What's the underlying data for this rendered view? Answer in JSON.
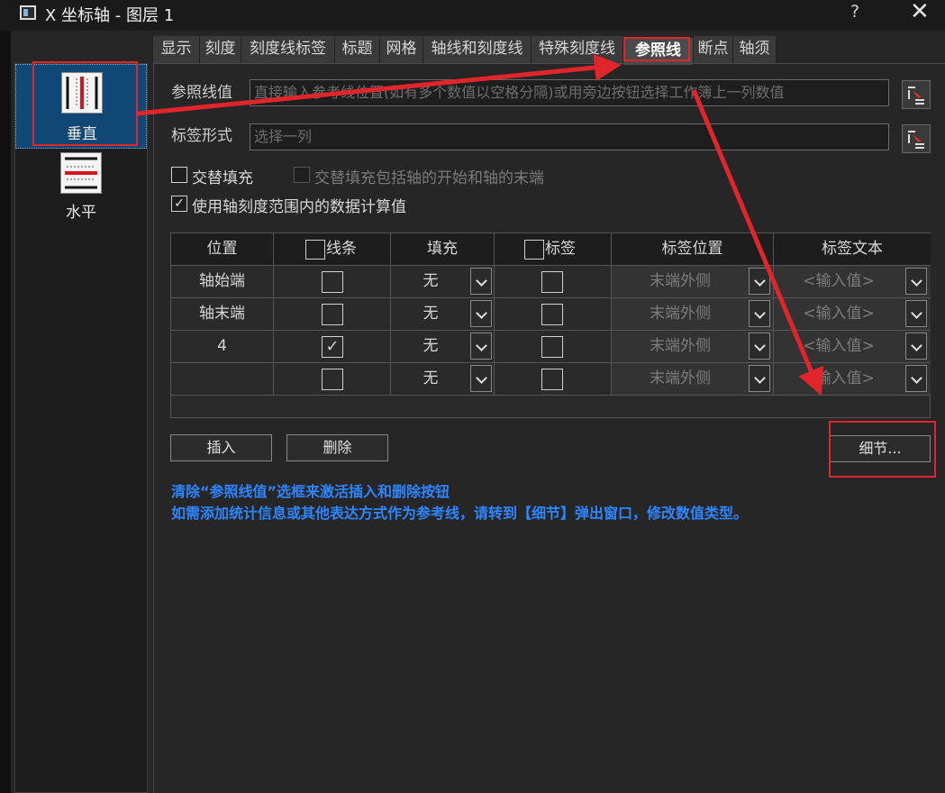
{
  "window": {
    "title": "X 坐标轴 - 图层 1",
    "help_label": "?",
    "close_label": "✕"
  },
  "sidebar": {
    "items": [
      {
        "label": "垂直",
        "icon": "vertical-axis-icon",
        "selected": true
      },
      {
        "label": "水平",
        "icon": "horizontal-axis-icon",
        "selected": false
      }
    ]
  },
  "tabs": [
    "显示",
    "刻度",
    "刻度线标签",
    "标题",
    "网格",
    "轴线和刻度线",
    "特殊刻度线",
    "参照线",
    "断点",
    "轴须"
  ],
  "active_tab": "参照线",
  "form": {
    "ref_value_label": "参照线值",
    "ref_value_placeholder": "直接输入参考线位置(如有多个数值以空格分隔)或用旁边按钮选择工作簿上一列数值",
    "label_format_label": "标签形式",
    "label_format_placeholder": "选择一列",
    "alt_fill_label": "交替填充",
    "alt_fill_checked": false,
    "alt_fill_ends_label": "交替填充包括轴的开始和轴的末端",
    "alt_fill_ends_enabled": false,
    "use_axis_range_label": "使用轴刻度范围内的数据计算值",
    "use_axis_range_checked": true
  },
  "grid": {
    "headers": [
      "位置",
      "线条",
      "填充",
      "标签",
      "标签位置",
      "标签文本"
    ],
    "rows": [
      {
        "position": "轴始端",
        "line": false,
        "fill": "无",
        "label": false,
        "label_pos": "末端外侧",
        "label_text": "<输入值>"
      },
      {
        "position": "轴末端",
        "line": false,
        "fill": "无",
        "label": false,
        "label_pos": "末端外侧",
        "label_text": "<输入值>"
      },
      {
        "position": "4",
        "line": true,
        "fill": "无",
        "label": false,
        "label_pos": "末端外侧",
        "label_text": "<输入值>"
      },
      {
        "position": "",
        "line": false,
        "fill": "无",
        "label": false,
        "label_pos": "末端外侧",
        "label_text": "<输入值>"
      }
    ]
  },
  "buttons": {
    "insert": "插入",
    "delete": "删除",
    "details": "细节..."
  },
  "info": [
    "清除“参照线值”选框来激活插入和删除按钮",
    "如需添加统计信息或其他表达方式作为参考线，请转到【细节】弹出窗口，修改数值类型。"
  ],
  "colors": {
    "annotation_red": "#e0252b",
    "info_blue": "#2d86ff",
    "selected_blue": "#0f4775"
  }
}
